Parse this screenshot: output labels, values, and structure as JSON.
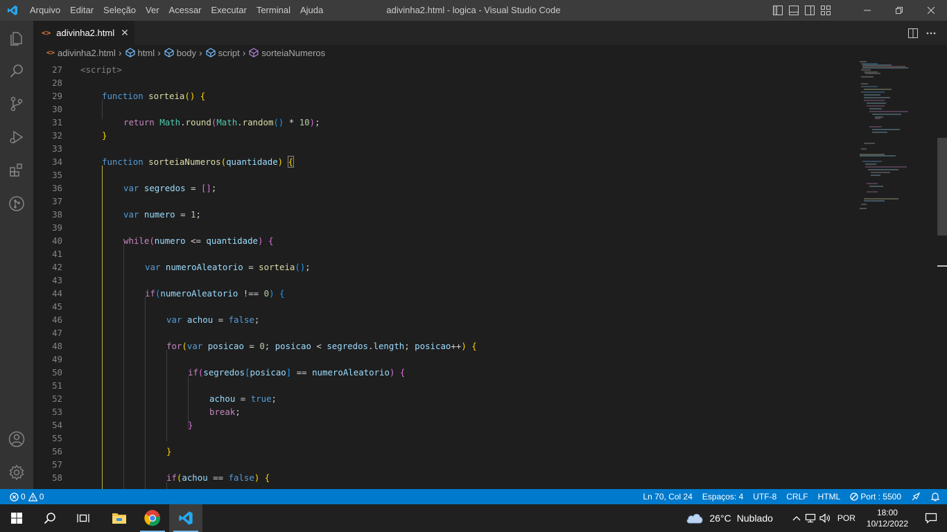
{
  "titlebar": {
    "menu": [
      "Arquivo",
      "Editar",
      "Seleção",
      "Ver",
      "Acessar",
      "Executar",
      "Terminal",
      "Ajuda"
    ],
    "window_title": "adivinha2.html - logica - Visual Studio Code"
  },
  "activitybar": [
    "explorer-icon",
    "search-icon",
    "source-control-icon",
    "run-debug-icon",
    "extensions-icon",
    "git-graph-icon",
    "accounts-icon",
    "manage-gear-icon"
  ],
  "tab": {
    "label": "adivinha2.html",
    "close": "✕"
  },
  "breadcrumb": {
    "file": "adivinha2.html",
    "items": [
      "html",
      "body",
      "script",
      "sorteiaNumeros"
    ]
  },
  "editor": {
    "lines": [
      {
        "n": "27"
      },
      {
        "n": "28"
      },
      {
        "n": "29"
      },
      {
        "n": "30"
      },
      {
        "n": "31"
      },
      {
        "n": "32"
      },
      {
        "n": "33"
      },
      {
        "n": "34"
      },
      {
        "n": "35"
      },
      {
        "n": "36"
      },
      {
        "n": "37"
      },
      {
        "n": "38"
      },
      {
        "n": "39"
      },
      {
        "n": "40"
      },
      {
        "n": "41"
      },
      {
        "n": "42"
      },
      {
        "n": "43"
      },
      {
        "n": "44"
      },
      {
        "n": "45"
      },
      {
        "n": "46"
      },
      {
        "n": "47"
      },
      {
        "n": "48"
      },
      {
        "n": "49"
      },
      {
        "n": "50"
      },
      {
        "n": "51"
      },
      {
        "n": "52"
      },
      {
        "n": "53"
      },
      {
        "n": "54"
      },
      {
        "n": "55"
      },
      {
        "n": "56"
      },
      {
        "n": "57"
      },
      {
        "n": "58"
      }
    ],
    "code": {
      "l27": "<script>",
      "l29_kw": "function",
      "l29_fn": "sorteia",
      "l29_rest": "() {",
      "l31_kw": "return",
      "l31_cls": "Math",
      "l31_fn": "round",
      "l31_cls2": "Math",
      "l31_fn2": "random",
      "l31_num": "10",
      "l34_kw": "function",
      "l34_fn": "sorteiaNumeros",
      "l34_param": "quantidade",
      "l36_kw": "var",
      "l36_var": "segredos",
      "l38_kw": "var",
      "l38_var": "numero",
      "l38_num": "1",
      "l40_kw": "while",
      "l40_var": "numero",
      "l40_var2": "quantidade",
      "l42_kw": "var",
      "l42_var": "numeroAleatorio",
      "l42_fn": "sorteia",
      "l44_kw": "if",
      "l44_var": "numeroAleatorio",
      "l44_num": "0",
      "l46_kw": "var",
      "l46_var": "achou",
      "l46_val": "false",
      "l48_kw": "for",
      "l48_kw2": "var",
      "l48_var": "posicao",
      "l48_num": "0",
      "l48_var2": "posicao",
      "l48_var3": "segredos",
      "l48_var4": "length",
      "l48_var5": "posicao",
      "l50_kw": "if",
      "l50_var": "segredos",
      "l50_var2": "posicao",
      "l50_var3": "numeroAleatorio",
      "l52_var": "achou",
      "l52_val": "true",
      "l53_kw": "break",
      "l58_kw": "if",
      "l58_var": "achou",
      "l58_val": "false"
    }
  },
  "statusbar": {
    "errors": "0",
    "warnings": "0",
    "position": "Ln 70, Col 24",
    "spaces": "Espaços: 4",
    "encoding": "UTF-8",
    "eol": "CRLF",
    "language": "HTML",
    "port": "Port : 5500"
  },
  "taskbar": {
    "apps": [
      "windows-start-icon",
      "search-icon",
      "task-view-icon",
      "file-explorer-icon",
      "chrome-icon",
      "vscode-icon"
    ],
    "weather_temp": "26°C",
    "weather_desc": "Nublado",
    "language": "POR",
    "time": "18:00",
    "date": "10/12/2022"
  },
  "colors": {
    "statusbar": "#007acc",
    "titlebar": "#3c3c3c",
    "activitybar": "#333333",
    "editor_bg": "#1e1e1e",
    "keyword": "#569cd6",
    "control": "#c586c0",
    "function": "#dcdcaa",
    "variable": "#9cdcfe"
  }
}
